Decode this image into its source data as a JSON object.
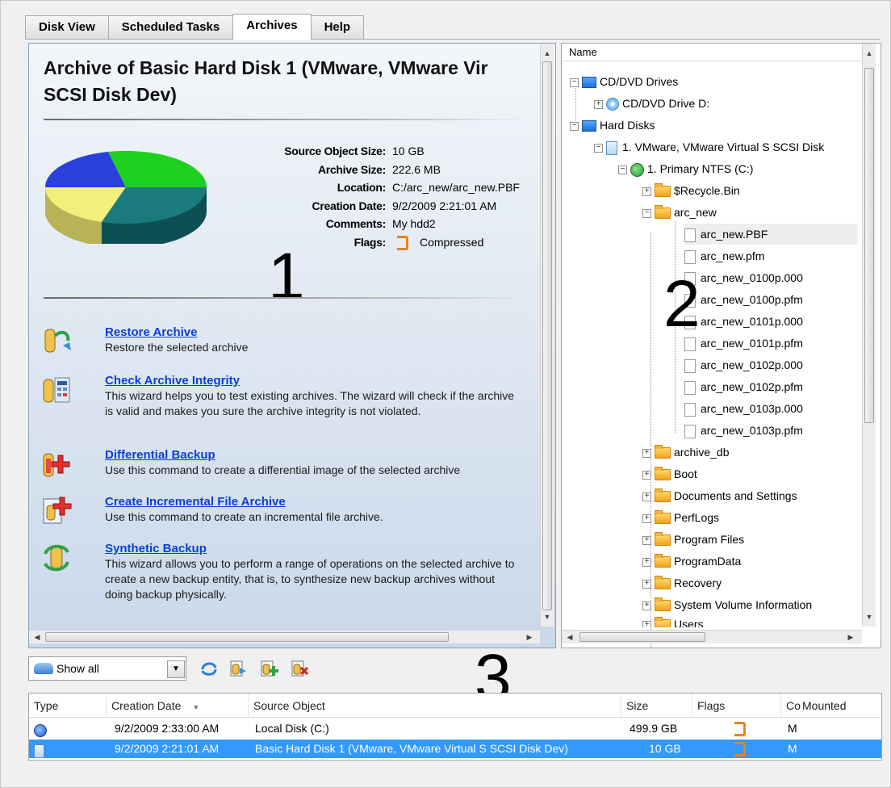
{
  "tabs": [
    {
      "label": "Disk View"
    },
    {
      "label": "Scheduled Tasks"
    },
    {
      "label": "Archives"
    },
    {
      "label": "Help"
    }
  ],
  "info_panel": {
    "title": "Archive of Basic Hard Disk 1 (VMware, VMware Vir SCSI Disk Dev)",
    "marker": "1",
    "properties": [
      {
        "key": "Source Object Size:",
        "value": "10 GB"
      },
      {
        "key": "Archive Size:",
        "value": "222.6 MB"
      },
      {
        "key": "Location:",
        "value": "C:/arc_new/arc_new.PBF"
      },
      {
        "key": "Creation Date:",
        "value": "9/2/2009 2:21:01 AM"
      },
      {
        "key": "Comments:",
        "value": "My hdd2"
      },
      {
        "key": "Flags:",
        "value": "Compressed"
      }
    ],
    "pie_colors": [
      "#1fd11f",
      "#2b3fdc",
      "#f2ef7a",
      "#1a7a7e"
    ],
    "actions": [
      {
        "icon": "restore-archive-icon",
        "label": "Restore Archive",
        "desc": "Restore the selected archive"
      },
      {
        "icon": "check-integrity-icon",
        "label": "Check Archive Integrity",
        "desc": "This wizard helps you to test existing archives. The wizard will check if the archive is valid and makes you sure the archive integrity is not violated."
      },
      {
        "icon": "differential-backup-icon",
        "label": "Differential Backup",
        "desc": "Use this command to create a differential image of the selected archive"
      },
      {
        "icon": "incremental-archive-icon",
        "label": "Create Incremental File Archive",
        "desc": "Use this command to create an incremental file archive."
      },
      {
        "icon": "synthetic-backup-icon",
        "label": "Synthetic Backup",
        "desc": "This wizard allows you to perform a range of operations on the selected archive to create a new backup entity, that is, to synthesize new backup archives without doing backup physically."
      }
    ]
  },
  "tree_panel": {
    "header": "Name",
    "marker": "2",
    "nodes": [
      {
        "label": "CD/DVD Drives"
      },
      {
        "label": "CD/DVD Drive D:"
      },
      {
        "label": "Hard Disks"
      },
      {
        "label": "1. VMware, VMware Virtual S SCSI Disk"
      },
      {
        "label": "1. Primary NTFS (C:)"
      },
      {
        "label": "$Recycle.Bin"
      },
      {
        "label": "arc_new"
      },
      {
        "label": "arc_new.PBF"
      },
      {
        "label": "arc_new.pfm"
      },
      {
        "label": "arc_new_0100p.000"
      },
      {
        "label": "arc_new_0100p.pfm"
      },
      {
        "label": "arc_new_0101p.000"
      },
      {
        "label": "arc_new_0101p.pfm"
      },
      {
        "label": "arc_new_0102p.000"
      },
      {
        "label": "arc_new_0102p.pfm"
      },
      {
        "label": "arc_new_0103p.000"
      },
      {
        "label": "arc_new_0103p.pfm"
      },
      {
        "label": "archive_db"
      },
      {
        "label": "Boot"
      },
      {
        "label": "Documents and Settings"
      },
      {
        "label": "PerfLogs"
      },
      {
        "label": "Program Files"
      },
      {
        "label": "ProgramData"
      },
      {
        "label": "Recovery"
      },
      {
        "label": "System Volume Information"
      },
      {
        "label": "Users"
      }
    ]
  },
  "archives_list": {
    "marker": "3",
    "filter": {
      "value": "Show all"
    },
    "columns": [
      "Type",
      "Creation Date",
      "Source Object",
      "Size",
      "Flags",
      "Co",
      "Mounted"
    ],
    "rows": [
      {
        "date": "9/2/2009 2:33:00 AM",
        "source": "Local Disk (C:)",
        "size": "499.9 GB",
        "comments": "M",
        "selected": false
      },
      {
        "date": "9/2/2009 2:21:01 AM",
        "source": "Basic Hard Disk 1 (VMware, VMware Virtual S SCSI Disk Dev)",
        "size": "10 GB",
        "comments": "M",
        "selected": true
      }
    ]
  }
}
